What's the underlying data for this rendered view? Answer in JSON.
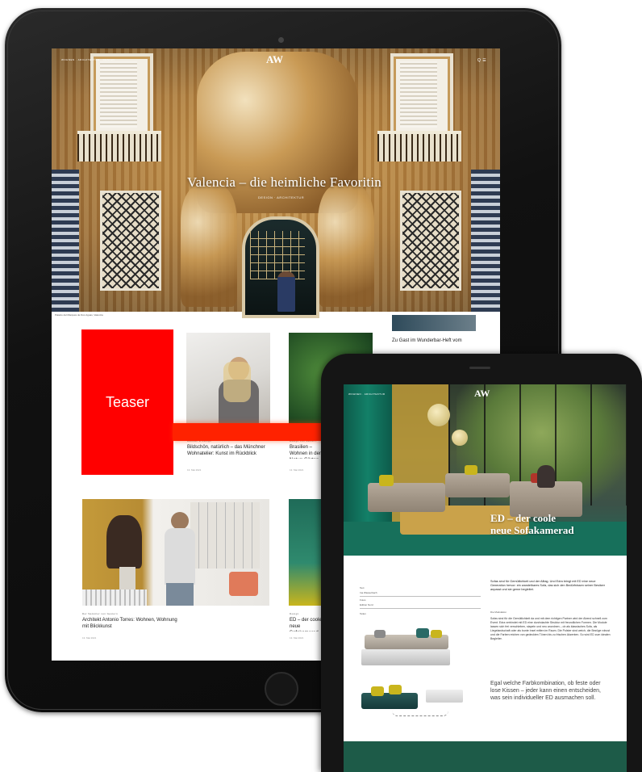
{
  "teaser": {
    "label": "Teaser"
  },
  "back_tablet": {
    "logo": "AW",
    "nav_left": "WOHNEN · ARCHITEKTUR · DESIGN",
    "nav_right": "Q ☰",
    "hero_title": "Valencia – die heimliche Favoritin",
    "hero_subtitle": "DESIGN · ARCHITEKTUR",
    "hero_caption": "Palacio del Marqués de Dos Aguas, Valencia",
    "cards": [
      {
        "category": "Wohnen & Design",
        "title": "Bildschön, natürlich – das Münchner Wohnatelier: Kunst im Rückblick",
        "date": "13. Mai 2021"
      },
      {
        "category": "Design von Gestern",
        "title": "Brasilien – Wohnen in der Natur: Gärten des Design",
        "date": "13. Mai 2021"
      },
      {
        "category": "",
        "title": "Zu Gast im Wunderbar-Heft vom",
        "date": ""
      },
      {
        "category": "Der Sammler von Gestern",
        "title": "Architekt Antonio Torres: Wohnen, Wohnung mit Blickkunst",
        "date": "13. Mai 2021"
      },
      {
        "category": "Design",
        "title": "ED – der coole neue Sofakamerad",
        "date": "13. Mai 2021"
      }
    ]
  },
  "front_tablet": {
    "logo": "AW",
    "nav_left": "WOHNEN · ARCHITEKTUR",
    "hero_title_line1": "ED – der coole",
    "hero_title_line2": "neue Sofakamerad",
    "meta_label1": "Text",
    "meta_value1": "Ina Wasserbach",
    "meta_label2": "Fotos",
    "meta_value2": "Edition Nord",
    "meta_label3": "Teilen",
    "intro": "Sofas sind für Gemütlichkeit und der Alltag. Und Edra bringt mit ED eine neue Generation hervor: ein wandelbares Sofa, das sich den Bedürfnissen seiner Besitzer anpasst und sie gerne begleitet.",
    "section_heading": "Die Modulation",
    "body": "Sofas sind für die Gemütlichkeit da und mit dem richtigen Partner wird der Abend schnell zum Event. Edra verbindet mit ED eine durchdachte Struktur mit freundlichen Formen. Die Module lassen sich frei verschieben, stapeln und neu anordnen – ob als klassisches Sofa, als Liegelandschaft oder als bunte Insel mitten im Raum. Die Polster sind weich, die Bezüge robust und die Farben reichen von gedeckten Tönen bis zu frischen Akzenten. So wird ED zum idealen Begleiter.",
    "pull_quote": "Egal welche Farbkombination, ob feste oder lose Kissen – jeder kann einen entscheiden, was sein individueller ED ausmachen soll."
  }
}
